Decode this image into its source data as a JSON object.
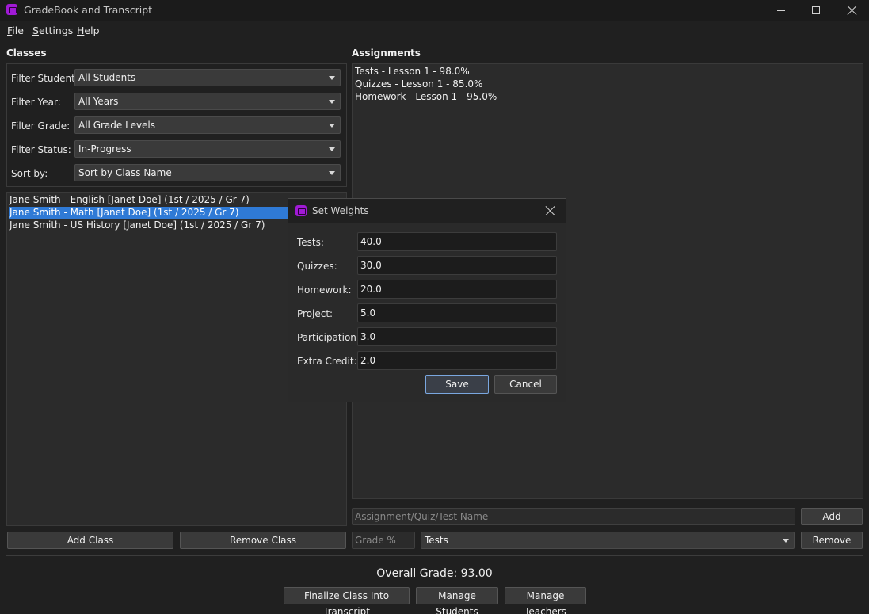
{
  "window": {
    "title": "GradeBook and Transcript"
  },
  "menu": {
    "file": "File",
    "settings": "Settings",
    "help": "Help"
  },
  "classes": {
    "heading": "Classes",
    "filters": [
      {
        "label": "Filter Student:",
        "value": "All Students"
      },
      {
        "label": "Filter Year:",
        "value": "All Years"
      },
      {
        "label": "Filter Grade:",
        "value": "All Grade Levels"
      },
      {
        "label": "Filter Status:",
        "value": "In-Progress"
      },
      {
        "label": "Sort by:",
        "value": "Sort by Class Name"
      }
    ],
    "items": [
      {
        "label": "Jane Smith - English [Janet Doe] (1st / 2025 / Gr 7)",
        "selected": false
      },
      {
        "label": "Jane Smith - Math [Janet Doe] (1st / 2025 / Gr 7)",
        "selected": true
      },
      {
        "label": "Jane Smith - US History [Janet Doe] (1st / 2025 / Gr 7)",
        "selected": false
      }
    ],
    "add_button": "Add Class",
    "remove_button": "Remove Class"
  },
  "assignments": {
    "heading": "Assignments",
    "items": [
      "Tests - Lesson 1 - 98.0%",
      "Quizzes - Lesson 1 - 85.0%",
      "Homework - Lesson 1 - 95.0%"
    ],
    "name_placeholder": "Assignment/Quiz/Test Name",
    "grade_placeholder": "Grade %",
    "category_value": "Tests",
    "add_button": "Add",
    "remove_button": "Remove"
  },
  "footer": {
    "overall_grade": "Overall Grade: 93.00",
    "finalize_button": "Finalize Class Into Transcript",
    "manage_students_button": "Manage Students",
    "manage_teachers_button": "Manage Teachers"
  },
  "dialog": {
    "title": "Set Weights",
    "fields": [
      {
        "label": "Tests:",
        "value": "40.0"
      },
      {
        "label": "Quizzes:",
        "value": "30.0"
      },
      {
        "label": "Homework:",
        "value": "20.0"
      },
      {
        "label": "Project:",
        "value": "5.0"
      },
      {
        "label": "Participation:",
        "value": "3.0"
      },
      {
        "label": "Extra Credit:",
        "value": "2.0"
      }
    ],
    "save_button": "Save",
    "cancel_button": "Cancel"
  },
  "colors": {
    "app_icon": "#a11ad6",
    "selection": "#2f7ad6",
    "background": "#202020"
  }
}
